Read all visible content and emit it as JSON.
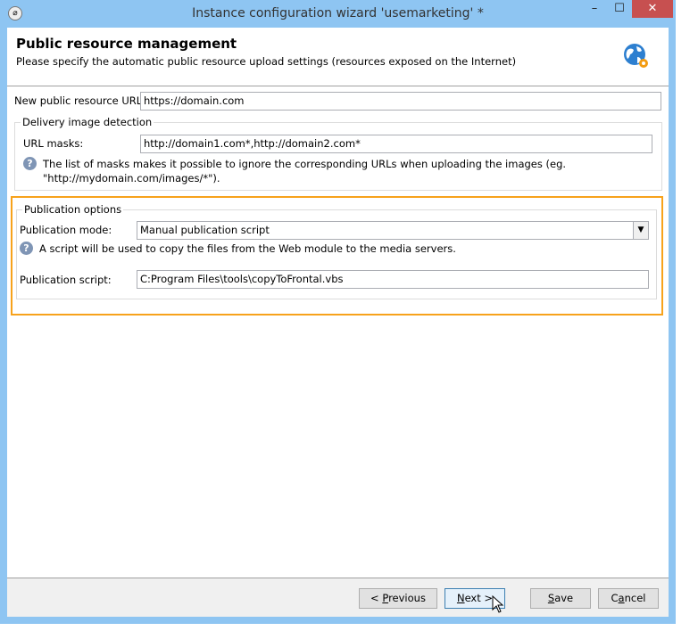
{
  "window": {
    "title": "Instance configuration wizard 'usemarketing' *"
  },
  "header": {
    "title": "Public resource management",
    "subtitle": "Please specify the automatic public resource upload settings (resources exposed on the Internet)",
    "icon": "globe-gear-icon"
  },
  "form": {
    "public_url_label": "New public resource URL:",
    "public_url_value": "https://domain.com",
    "delivery_group": "Delivery image detection",
    "url_masks_label": "URL masks:",
    "url_masks_value": "http://domain1.com*,http://domain2.com*",
    "url_masks_help_1": "The list of masks makes it possible to ignore the corresponding URLs when uploading the images (eg.",
    "url_masks_help_2": "\"http://mydomain.com/images/*\").",
    "publication_group": "Publication options",
    "mode_label": "Publication mode:",
    "mode_value": "Manual publication script",
    "mode_help": "A script will be used to copy the files from the Web module to the media servers.",
    "script_label": "Publication script:",
    "script_value": "C:Program Files\\tools\\copyToFrontal.vbs"
  },
  "buttons": {
    "previous_pre": "< ",
    "previous_u": "P",
    "previous_post": "revious",
    "next_u": "N",
    "next_post": "ext >",
    "save_u": "S",
    "save_post": "ave",
    "cancel_pre": "C",
    "cancel_u": "a",
    "cancel_post": "ncel"
  },
  "colors": {
    "highlight": "#f7a21b",
    "frame": "#8ec5f2",
    "close": "#c75050"
  }
}
